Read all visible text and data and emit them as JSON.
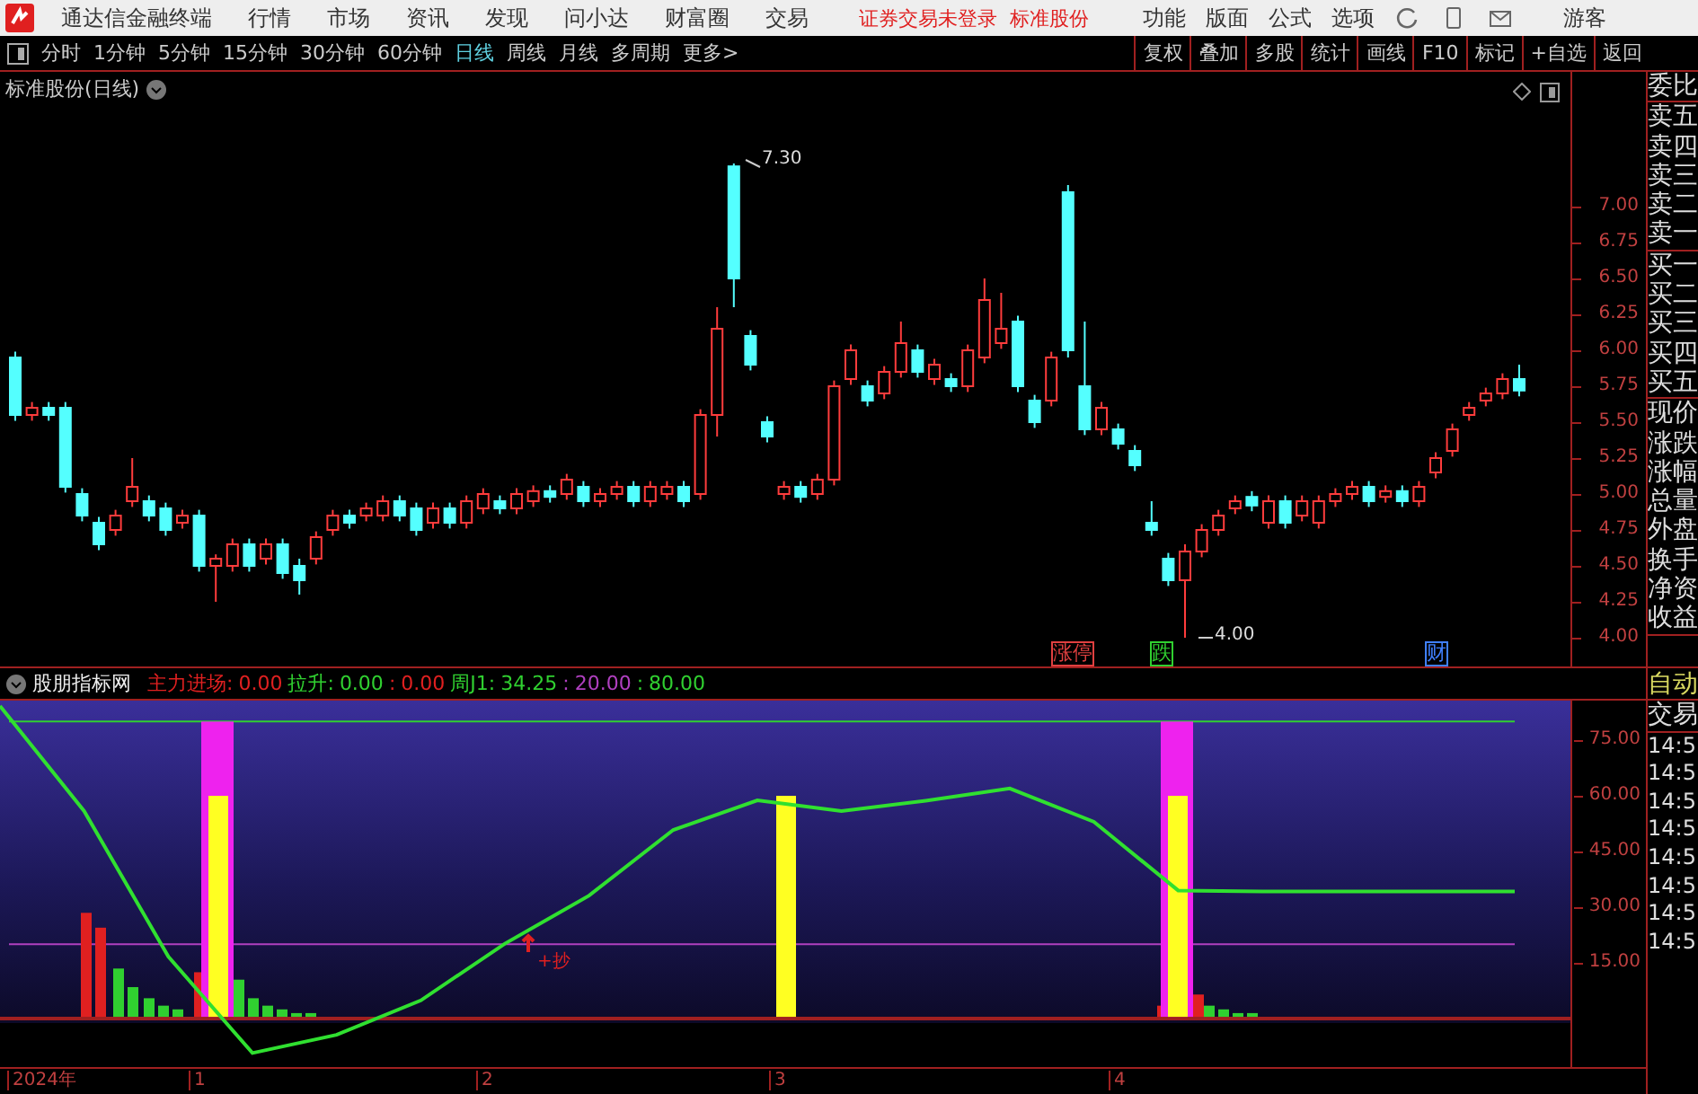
{
  "menu_bar": {
    "app_title": "通达信金融终端",
    "items": [
      "行情",
      "市场",
      "资讯",
      "发现",
      "问小达",
      "财富圈",
      "交易"
    ],
    "notices": [
      "证券交易未登录",
      "标准股份"
    ],
    "tools": [
      "功能",
      "版面",
      "公式",
      "选项"
    ],
    "user": "游客"
  },
  "toolbar": {
    "periods": [
      {
        "label": "分时",
        "selected": false
      },
      {
        "label": "1分钟",
        "selected": false
      },
      {
        "label": "5分钟",
        "selected": false
      },
      {
        "label": "15分钟",
        "selected": false
      },
      {
        "label": "30分钟",
        "selected": false
      },
      {
        "label": "60分钟",
        "selected": false
      },
      {
        "label": "日线",
        "selected": true
      },
      {
        "label": "周线",
        "selected": false
      },
      {
        "label": "月线",
        "selected": false
      },
      {
        "label": "多周期",
        "selected": false
      },
      {
        "label": "更多>",
        "selected": false
      }
    ],
    "actions": [
      "复权",
      "叠加",
      "多股",
      "统计",
      "画线",
      "F10",
      "标记",
      "+自选",
      "返回"
    ]
  },
  "price_chart": {
    "title": "标准股份(日线)",
    "high_label": "7.30",
    "low_label": "4.00",
    "markers": [
      {
        "text": "涨停",
        "color": "#e04040"
      },
      {
        "text": "跌",
        "color": "#30d030"
      },
      {
        "text": "财",
        "color": "#4080ff"
      }
    ],
    "chart_data": {
      "type": "candlestick",
      "ylim": [
        3.7875,
        7.9375
      ],
      "categories": [
        null,
        null,
        null,
        null,
        null,
        null,
        null,
        null,
        null,
        null,
        null,
        null,
        null,
        null,
        null,
        null,
        null,
        null,
        null,
        null,
        null,
        null,
        null,
        null,
        null,
        null,
        null,
        null,
        null,
        null,
        null,
        null,
        null,
        null,
        null,
        null,
        null,
        null,
        null,
        null,
        null,
        null,
        null,
        null,
        null,
        null,
        null,
        null,
        null,
        null,
        null,
        null,
        null,
        null,
        null,
        null,
        null,
        null,
        null,
        null,
        null,
        null,
        null,
        null,
        null,
        null,
        null,
        null,
        null,
        null,
        null,
        null,
        null,
        null,
        null,
        null,
        null,
        null,
        null,
        null,
        null,
        null,
        null,
        null,
        null,
        null,
        null,
        null,
        null,
        null,
        null
      ],
      "yticks": [
        {
          "value": 7,
          "label": "7.00"
        },
        {
          "value": 6.75,
          "label": "6.75"
        },
        {
          "value": 6.5,
          "label": "6.50"
        },
        {
          "value": 6.25,
          "label": "6.25"
        },
        {
          "value": 6,
          "label": "6.00"
        },
        {
          "value": 5.75,
          "label": "5.75"
        },
        {
          "value": 5.5,
          "label": "5.50"
        },
        {
          "value": 5.25,
          "label": "5.25"
        },
        {
          "value": 5,
          "label": "5.00"
        },
        {
          "value": 4.75,
          "label": "4.75"
        },
        {
          "value": 4.5,
          "label": "4.50"
        },
        {
          "value": 4.25,
          "label": "4.25"
        },
        {
          "value": 4,
          "label": "4.00"
        }
      ],
      "ohlc": [
        [
          5.95,
          5.99,
          5.51,
          5.55
        ],
        [
          5.55,
          5.64,
          5.51,
          5.6
        ],
        [
          5.6,
          5.64,
          5.51,
          5.55
        ],
        [
          5.6,
          5.64,
          5.01,
          5.05
        ],
        [
          5.0,
          5.04,
          4.81,
          4.85
        ],
        [
          4.8,
          4.84,
          4.61,
          4.65
        ],
        [
          4.75,
          4.89,
          4.71,
          4.85
        ],
        [
          4.95,
          5.25,
          4.91,
          5.05
        ],
        [
          4.95,
          4.99,
          4.81,
          4.85
        ],
        [
          4.9,
          4.94,
          4.71,
          4.75
        ],
        [
          4.8,
          4.89,
          4.76,
          4.85
        ],
        [
          4.85,
          4.89,
          4.46,
          4.5
        ],
        [
          4.5,
          4.58,
          4.25,
          4.55
        ],
        [
          4.5,
          4.69,
          4.46,
          4.65
        ],
        [
          4.65,
          4.69,
          4.46,
          4.5
        ],
        [
          4.55,
          4.69,
          4.51,
          4.65
        ],
        [
          4.65,
          4.69,
          4.41,
          4.45
        ],
        [
          4.5,
          4.55,
          4.3,
          4.4
        ],
        [
          4.55,
          4.74,
          4.51,
          4.7
        ],
        [
          4.75,
          4.89,
          4.71,
          4.85
        ],
        [
          4.85,
          4.89,
          4.76,
          4.8
        ],
        [
          4.85,
          4.94,
          4.81,
          4.9
        ],
        [
          4.85,
          4.99,
          4.81,
          4.95
        ],
        [
          4.95,
          4.99,
          4.81,
          4.85
        ],
        [
          4.9,
          4.94,
          4.71,
          4.75
        ],
        [
          4.8,
          4.94,
          4.76,
          4.9
        ],
        [
          4.9,
          4.94,
          4.76,
          4.8
        ],
        [
          4.8,
          4.99,
          4.76,
          4.95
        ],
        [
          4.9,
          5.04,
          4.86,
          5.0
        ],
        [
          4.95,
          4.99,
          4.86,
          4.9
        ],
        [
          4.9,
          5.04,
          4.86,
          5.0
        ],
        [
          4.95,
          5.06,
          4.91,
          5.02
        ],
        [
          5.02,
          5.06,
          4.94,
          4.98
        ],
        [
          5.0,
          5.14,
          4.96,
          5.1
        ],
        [
          5.05,
          5.09,
          4.91,
          4.95
        ],
        [
          4.95,
          5.04,
          4.91,
          5.0
        ],
        [
          5.0,
          5.09,
          4.96,
          5.05
        ],
        [
          5.05,
          5.09,
          4.91,
          4.95
        ],
        [
          4.95,
          5.09,
          4.91,
          5.05
        ],
        [
          5.0,
          5.09,
          4.96,
          5.05
        ],
        [
          5.05,
          5.09,
          4.91,
          4.95
        ],
        [
          5.0,
          5.59,
          4.96,
          5.55
        ],
        [
          5.55,
          6.3,
          5.4,
          6.15
        ],
        [
          7.28,
          7.3,
          6.3,
          6.5
        ],
        [
          6.1,
          6.14,
          5.86,
          5.9
        ],
        [
          5.5,
          5.54,
          5.36,
          5.4
        ],
        [
          5.0,
          5.09,
          4.96,
          5.05
        ],
        [
          5.05,
          5.09,
          4.94,
          4.98
        ],
        [
          5.0,
          5.14,
          4.96,
          5.1
        ],
        [
          5.1,
          5.79,
          5.06,
          5.75
        ],
        [
          5.8,
          6.04,
          5.76,
          6.0
        ],
        [
          5.75,
          5.79,
          5.61,
          5.65
        ],
        [
          5.7,
          5.89,
          5.66,
          5.85
        ],
        [
          5.85,
          6.2,
          5.81,
          6.05
        ],
        [
          6.0,
          6.04,
          5.81,
          5.85
        ],
        [
          5.8,
          5.94,
          5.76,
          5.9
        ],
        [
          5.8,
          5.84,
          5.71,
          5.75
        ],
        [
          5.75,
          6.04,
          5.71,
          6.0
        ],
        [
          5.95,
          6.5,
          5.91,
          6.35
        ],
        [
          6.05,
          6.4,
          6.01,
          6.15
        ],
        [
          6.2,
          6.24,
          5.71,
          5.75
        ],
        [
          5.65,
          5.69,
          5.46,
          5.5
        ],
        [
          5.65,
          5.99,
          5.61,
          5.95
        ],
        [
          7.1,
          7.15,
          5.95,
          6.0
        ],
        [
          5.75,
          6.2,
          5.41,
          5.45
        ],
        [
          5.45,
          5.64,
          5.41,
          5.6
        ],
        [
          5.45,
          5.49,
          5.31,
          5.35
        ],
        [
          5.3,
          5.34,
          5.16,
          5.2
        ],
        [
          4.8,
          4.95,
          4.71,
          4.75
        ],
        [
          4.55,
          4.59,
          4.36,
          4.4
        ],
        [
          4.4,
          4.65,
          4.0,
          4.6
        ],
        [
          4.6,
          4.79,
          4.56,
          4.75
        ],
        [
          4.75,
          4.89,
          4.71,
          4.85
        ],
        [
          4.9,
          4.99,
          4.86,
          4.95
        ],
        [
          4.98,
          5.02,
          4.88,
          4.92
        ],
        [
          4.8,
          4.99,
          4.76,
          4.95
        ],
        [
          4.95,
          4.99,
          4.76,
          4.8
        ],
        [
          4.85,
          4.99,
          4.81,
          4.95
        ],
        [
          4.8,
          4.99,
          4.76,
          4.95
        ],
        [
          4.95,
          5.04,
          4.91,
          5.0
        ],
        [
          5.0,
          5.09,
          4.96,
          5.05
        ],
        [
          5.05,
          5.09,
          4.91,
          4.95
        ],
        [
          4.98,
          5.06,
          4.94,
          5.02
        ],
        [
          5.02,
          5.06,
          4.91,
          4.95
        ],
        [
          4.95,
          5.09,
          4.91,
          5.05
        ],
        [
          5.15,
          5.29,
          5.11,
          5.25
        ],
        [
          5.3,
          5.49,
          5.26,
          5.45
        ],
        [
          5.55,
          5.64,
          5.51,
          5.6
        ],
        [
          5.65,
          5.74,
          5.61,
          5.7
        ],
        [
          5.7,
          5.84,
          5.66,
          5.8
        ],
        [
          5.8,
          5.9,
          5.68,
          5.72
        ]
      ]
    }
  },
  "indicator": {
    "name": "股朋指标网",
    "legend": [
      {
        "text": "主力进场:",
        "color": "#e02020"
      },
      {
        "text": "0.00",
        "color": "#e02020"
      },
      {
        "text": "拉升:",
        "color": "#30d030"
      },
      {
        "text": "0.00",
        "color": "#30d030"
      },
      {
        "text": ":",
        "color": "#e02020"
      },
      {
        "text": "0.00",
        "color": "#e02020"
      },
      {
        "text": "周J1:",
        "color": "#30d030"
      },
      {
        "text": "34.25",
        "color": "#30d030"
      },
      {
        "text": ":",
        "color": "#b040c0"
      },
      {
        "text": "20.00",
        "color": "#b040c0"
      },
      {
        "text": ":",
        "color": "#30d030"
      },
      {
        "text": "80.00",
        "color": "#30d030"
      }
    ],
    "signal_label": "+抄",
    "chart_data": {
      "type": "line",
      "ylim": [
        -13.05,
        85.64
      ],
      "categories": [
        null,
        null,
        null,
        null,
        null,
        null,
        null,
        null,
        null,
        null,
        null,
        null,
        null,
        null,
        null,
        null,
        null,
        null,
        null
      ],
      "yticks": [
        {
          "value": 75,
          "label": "75.00"
        },
        {
          "value": 60,
          "label": "60.00"
        },
        {
          "value": 45,
          "label": "45.00"
        },
        {
          "value": 30,
          "label": "30.00"
        },
        {
          "value": 15,
          "label": "15.00"
        }
      ],
      "series": [
        {
          "color": "#30e030",
          "values": [
            84.2,
            55.9,
            16.7,
            -9.3,
            -4.4,
            4.9,
            20.2,
            33.1,
            50.8,
            58.8,
            55.9,
            58.7,
            62.0,
            53.0,
            34.5,
            34.25,
            34.25,
            34.25,
            34.25
          ]
        }
      ]
    }
  },
  "date_axis": [
    "2024年",
    "1",
    "2",
    "3",
    "4"
  ],
  "sidebar": {
    "quote_groups": [
      [
        "委比"
      ],
      [
        "卖五",
        "卖四",
        "卖三",
        "卖二",
        "卖一"
      ],
      [
        "买一",
        "买二",
        "买三",
        "买四",
        "买五"
      ],
      [
        "现价",
        "涨跌",
        "涨幅",
        "总量",
        "外盘",
        "换手",
        "净资",
        "收益"
      ]
    ],
    "auto_label": "自动",
    "trade_label": "交易",
    "times": [
      "14:5",
      "14:5",
      "14:5",
      "14:5",
      "14:5",
      "14:5",
      "14:5",
      "14:5"
    ]
  }
}
